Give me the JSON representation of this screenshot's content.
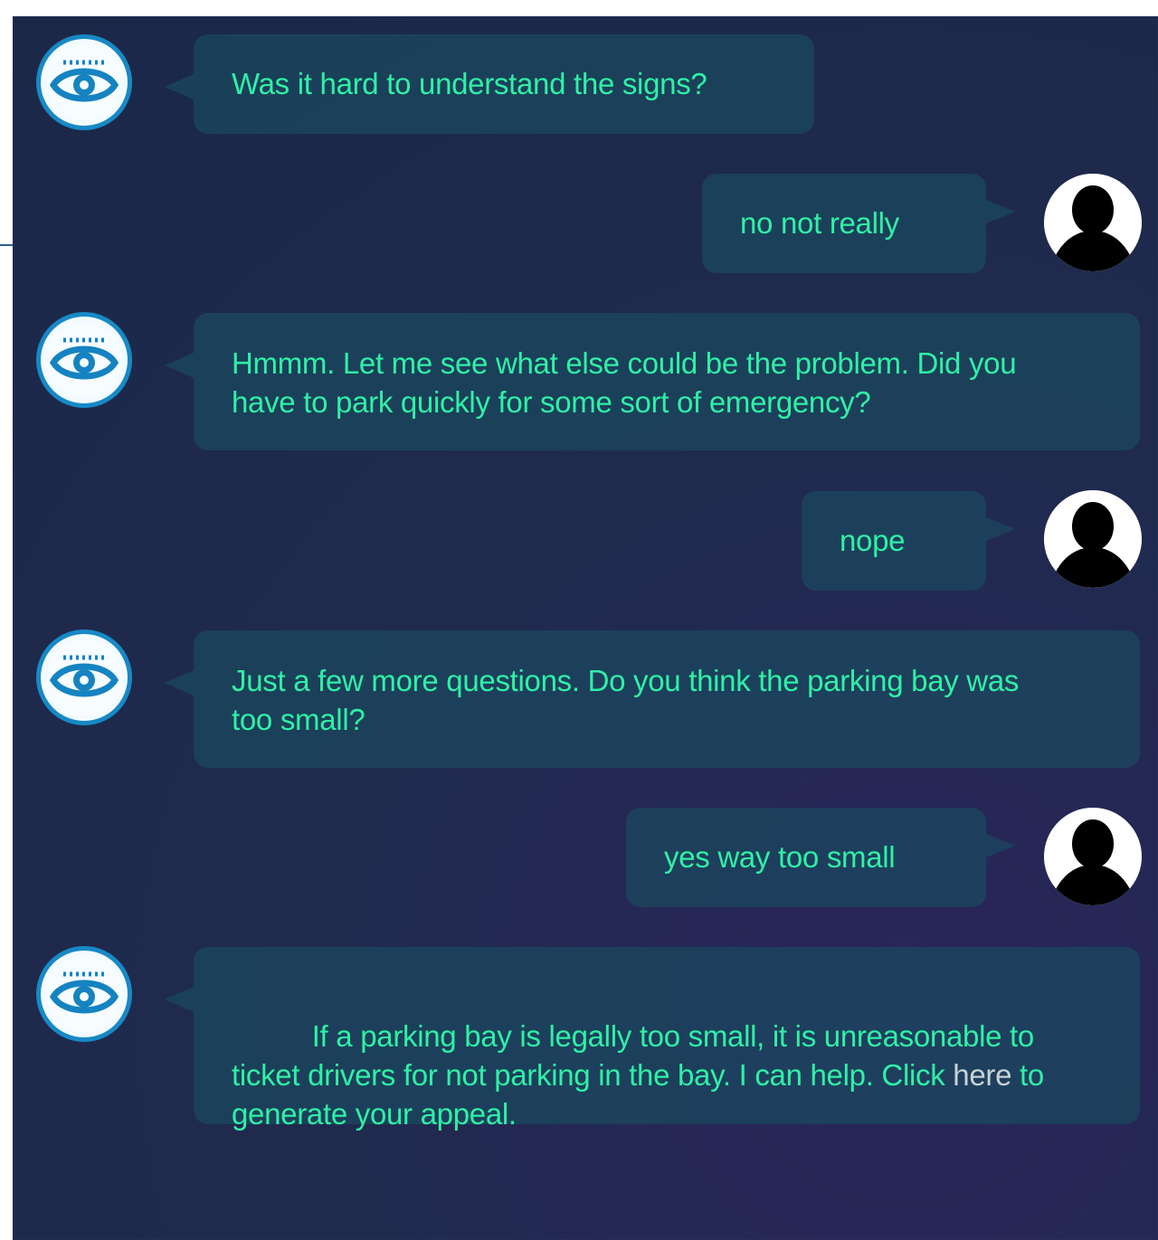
{
  "messages": [
    {
      "sender": "bot",
      "text": "Was it hard to understand the signs?"
    },
    {
      "sender": "user",
      "text": "no not really"
    },
    {
      "sender": "bot",
      "text": "Hmmm. Let me see what else could be the problem. Did you have to park quickly for some sort of emergency?"
    },
    {
      "sender": "user",
      "text": "nope"
    },
    {
      "sender": "bot",
      "text": "Just a few more questions. Do you think the parking bay was too small?"
    },
    {
      "sender": "user",
      "text": "yes way too small"
    },
    {
      "sender": "bot",
      "text_before_link": "If a parking bay is legally too small, it is unreasonable to ticket drivers for not parking in the bay. I can help. Click ",
      "link_text": "here",
      "text_after_link": " to generate your appeal."
    }
  ],
  "colors": {
    "background": "#1b2848",
    "bubble": "#1b4960",
    "message_text": "#2ff0a6",
    "link_text": "#c8d2d5",
    "bot_avatar_ring": "#1789c6",
    "user_avatar": "#000000"
  },
  "icons": {
    "bot_avatar": "eye-icon",
    "user_avatar": "user-silhouette-icon"
  }
}
